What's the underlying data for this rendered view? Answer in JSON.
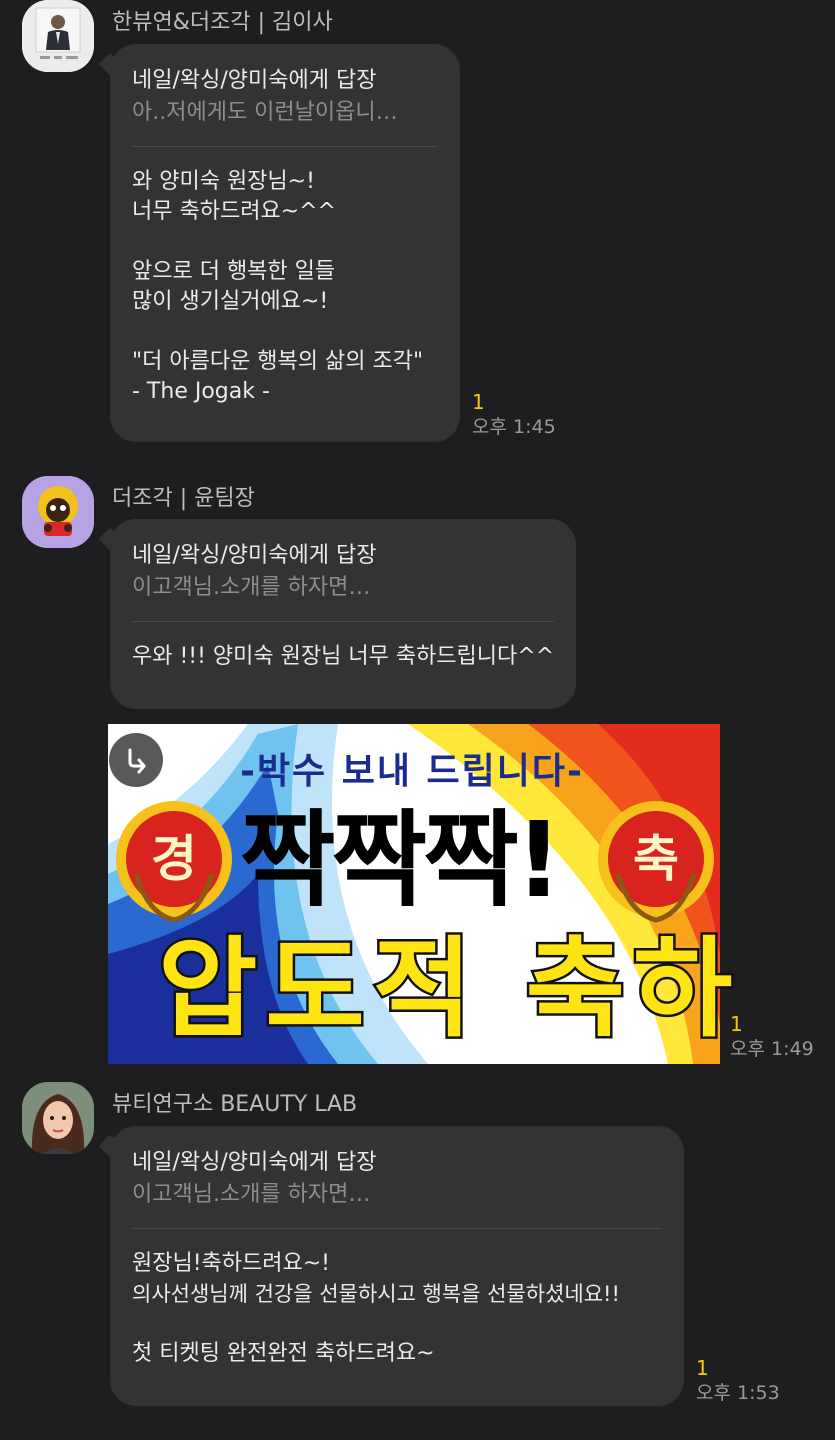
{
  "messages": [
    {
      "sender": "한뷰연&더조각 | 김이사",
      "reply_to": "네일/왁싱/양미숙에게 답장",
      "reply_quote": "아..저에게도 이런날이옵니…",
      "lines": [
        "와 양미숙 원장님~!",
        "너무 축하드려요~^^",
        "",
        "앞으로 더 행복한 일들",
        "많이 생기실거에요~!",
        "",
        "\"더 아름다운 행복의 삶의 조각\"",
        "- The Jogak -"
      ],
      "unread": "1",
      "time": "오후 1:45"
    },
    {
      "sender": "더조각 | 윤팀장",
      "reply_to": "네일/왁싱/양미숙에게 답장",
      "reply_quote": "이고객님.소개를 하자면…",
      "lines": [
        "우와 !!! 양미숙 원장님 너무 축하드립니다^^"
      ]
    },
    {
      "image": {
        "top_text": "-박수 보내 드립니다-",
        "main_text": "짝짝짝!",
        "sub_text": "압도적 축하",
        "seal_left": "경",
        "seal_right": "축"
      },
      "unread": "1",
      "time": "오후 1:49"
    },
    {
      "sender": "뷰티연구소 BEAUTY LAB",
      "reply_to": "네일/왁싱/양미숙에게 답장",
      "reply_quote": "이고객님.소개를 하자면…",
      "lines": [
        "원장님!축하드려요~!",
        "의사선생님께 건강을 선물하시고 행복을 선물하셨네요!!",
        "",
        "첫 티켓팅 완전완전 축하드려요~"
      ],
      "unread": "1",
      "time": "오후 1:53"
    }
  ],
  "icons": {
    "share": "share-arrow-icon",
    "avatar1": "man-in-suit-avatar",
    "avatar2": "cartoon-character-avatar",
    "avatar3": "woman-portrait-avatar"
  },
  "colors": {
    "background": "#1e1e20",
    "bubble": "#333336",
    "unread": "#f5c518",
    "muted": "#8d8d8f"
  }
}
